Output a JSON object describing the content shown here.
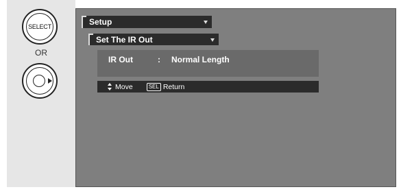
{
  "remote": {
    "select_button_label": "SELECT",
    "or_label": "OR",
    "enter_icon": "enter-arrow-icon"
  },
  "menu": {
    "setup_label": "Setup",
    "submenu_label": "Set The IR Out",
    "setting": {
      "name": "IR Out",
      "separator": ":",
      "value": "Normal Length"
    },
    "help": {
      "move_label": "Move",
      "sel_badge": "SEL",
      "return_label": "Return"
    }
  },
  "colors": {
    "screen_bg": "#7f7f7f",
    "bar_bg": "#2b2b2b",
    "content_bg": "#6a6a6a",
    "panel_bg": "#e6e6e6"
  }
}
